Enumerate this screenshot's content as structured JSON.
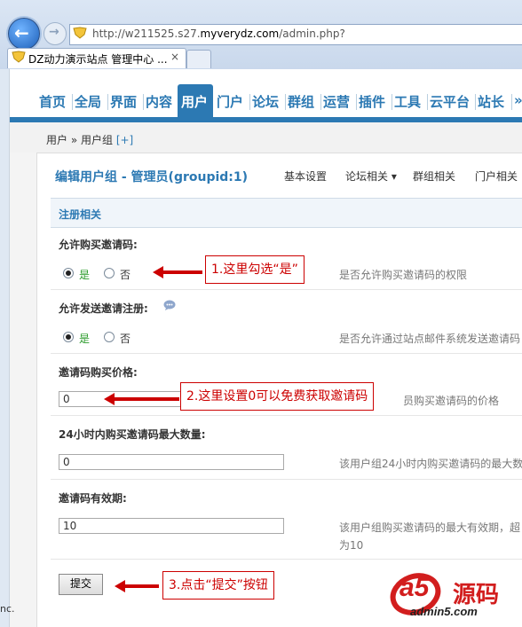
{
  "browser": {
    "url_prefix": "http://w211525.s27.",
    "url_domain": "myverydz.com",
    "url_suffix": "/admin.php?",
    "tab_title": "DZ动力演示站点 管理中心 ...",
    "tab_close": "×"
  },
  "menu": {
    "items": [
      "首页",
      "全局",
      "界面",
      "内容",
      "用户",
      "门户",
      "论坛",
      "群组",
      "运营",
      "插件",
      "工具",
      "云平台",
      "站长",
      "»"
    ],
    "active_index": 4
  },
  "breadcrumb": {
    "path": "用户 » 用户组",
    "add": "[+]"
  },
  "header": {
    "title": "编辑用户组 - 管理员(groupid:1)",
    "subnav": [
      "基本设置",
      "论坛相关 ▾",
      "群组相关",
      "门户相关"
    ]
  },
  "section": {
    "title": "注册相关"
  },
  "settings": {
    "allow_buy": {
      "label": "允许购买邀请码:",
      "yes": "是",
      "no": "否",
      "selected": "yes",
      "hint": "是否允许购买邀请码的权限"
    },
    "allow_send": {
      "label": "允许发送邀请注册:",
      "yes": "是",
      "no": "否",
      "selected": "yes",
      "hint": "是否允许通过站点邮件系统发送邀请码"
    },
    "price": {
      "label": "邀请码购买价格:",
      "value": "0",
      "hint": "员购买邀请码的价格"
    },
    "max_24h": {
      "label": "24小时内购买邀请码最大数量:",
      "value": "0",
      "hint": "该用户组24小时内购买邀请码的最大数"
    },
    "validity": {
      "label": "邀请码有效期:",
      "value": "10",
      "hint": "该用户组购买邀请码的最大有效期，超",
      "hint2": "为10"
    }
  },
  "submit_label": "提交",
  "annotations": {
    "note1": "1.这里勾选“是”",
    "note2": "2.这里设置0可以免费获取邀请码",
    "note3": "3.点击“提交”按钮"
  },
  "footer_fragment": "nc.",
  "watermark": {
    "brand": "a5",
    "cn": "源码",
    "site": "admin5.com"
  },
  "colors": {
    "accent": "#2c79b3",
    "annotation": "#cc0000",
    "yes": "#2a9a2a"
  }
}
